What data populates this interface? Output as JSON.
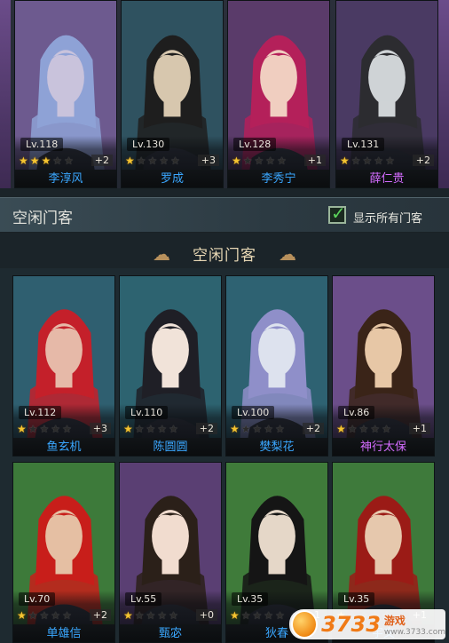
{
  "top_heroes": [
    {
      "level": "Lv.118",
      "stars": 3,
      "plus": "+2",
      "name": "李淳风",
      "name_color": "#3aa7ff",
      "palette": [
        "#6d5a8f",
        "#c9c3dc",
        "#8ea2d6"
      ]
    },
    {
      "level": "Lv.130",
      "stars": 1,
      "plus": "+3",
      "name": "罗成",
      "name_color": "#3aa7ff",
      "palette": [
        "#2f5260",
        "#d7c7ae",
        "#1e1e1e"
      ]
    },
    {
      "level": "Lv.128",
      "stars": 1,
      "plus": "+1",
      "name": "李秀宁",
      "name_color": "#3aa7ff",
      "palette": [
        "#5a3b6a",
        "#f0cec0",
        "#b4205a"
      ]
    },
    {
      "level": "Lv.131",
      "stars": 1,
      "plus": "+2",
      "name": "薛仁贵",
      "name_color": "#d46cff",
      "palette": [
        "#4a3a63",
        "#cfd3d6",
        "#2c2c30"
      ]
    }
  ],
  "section": {
    "title": "空闲门客",
    "show_all_label": "显示所有门客",
    "show_all_checked": true
  },
  "banner": {
    "title": "空闲门客"
  },
  "idle_heroes": [
    {
      "level": "Lv.112",
      "stars": 1,
      "plus": "+3",
      "name": "鱼玄机",
      "name_color": "#3aa7ff",
      "palette": [
        "#2f5f70",
        "#e6b9a8",
        "#c4202a"
      ]
    },
    {
      "level": "Lv.110",
      "stars": 1,
      "plus": "+2",
      "name": "陈圆圆",
      "name_color": "#3aa7ff",
      "palette": [
        "#2d6370",
        "#f1e3d9",
        "#1f1f26"
      ]
    },
    {
      "level": "Lv.100",
      "stars": 1,
      "plus": "+2",
      "name": "樊梨花",
      "name_color": "#3aa7ff",
      "palette": [
        "#2e6272",
        "#dde2ee",
        "#8f8fc9"
      ]
    },
    {
      "level": "Lv.86",
      "stars": 1,
      "plus": "+1",
      "name": "神行太保",
      "name_color": "#d46cff",
      "palette": [
        "#6b4e8a",
        "#e7c7a6",
        "#3a2418"
      ]
    },
    {
      "level": "Lv.70",
      "stars": 1,
      "plus": "+2",
      "name": "单雄信",
      "name_color": "#3aa7ff",
      "palette": [
        "#3d7a3a",
        "#e5bfa3",
        "#c81e1a"
      ]
    },
    {
      "level": "Lv.55",
      "stars": 1,
      "plus": "+0",
      "name": "甄宓",
      "name_color": "#3aa7ff",
      "palette": [
        "#5a3f73",
        "#f1dccf",
        "#2b2019"
      ]
    },
    {
      "level": "Lv.35",
      "stars": 1,
      "plus": "+1",
      "name": "狄春",
      "name_color": "#3aa7ff",
      "palette": [
        "#3f7b3a",
        "#e5d7c8",
        "#151515"
      ]
    },
    {
      "level": "Lv.35",
      "stars": 1,
      "plus": "+1",
      "name": "宇文",
      "name_color": "#3aa7ff",
      "palette": [
        "#3e7a3b",
        "#e6c8ad",
        "#9b1b16"
      ]
    }
  ],
  "watermark": {
    "number": "3733",
    "line1": "游戏",
    "line2": "www.3733.com"
  }
}
